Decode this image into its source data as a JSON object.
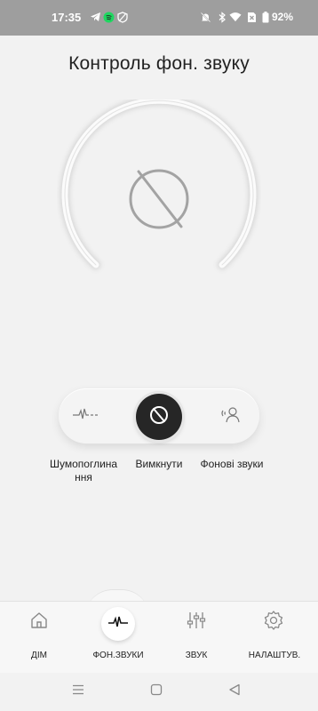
{
  "status": {
    "time": "17:35",
    "battery": "92%"
  },
  "page": {
    "title": "Контроль фон. звуку"
  },
  "gauge": {
    "state_icon": "prohibited-circle-icon"
  },
  "modes": {
    "selected": "off",
    "items": [
      {
        "id": "anc",
        "label": "Шумопоглина ння",
        "icon": "waveform-icon"
      },
      {
        "id": "off",
        "label": "Вимкнути",
        "icon": "prohibited-circle-icon"
      },
      {
        "id": "ambient",
        "label": "Фонові звуки",
        "icon": "person-sound-icon"
      }
    ]
  },
  "nav": {
    "items": [
      {
        "id": "home",
        "label": "ДІМ",
        "icon": "home-icon"
      },
      {
        "id": "ambient",
        "label": "ФОН.ЗВУКИ",
        "icon": "waveform-icon",
        "active": true
      },
      {
        "id": "sound",
        "label": "ЗВУК",
        "icon": "equalizer-icon"
      },
      {
        "id": "settings",
        "label": "НАЛАШТУВ.",
        "icon": "gear-icon"
      }
    ]
  },
  "colors": {
    "status_bar": "#9e9e9e",
    "background": "#f2f2f2",
    "selected_mode": "#262626"
  }
}
